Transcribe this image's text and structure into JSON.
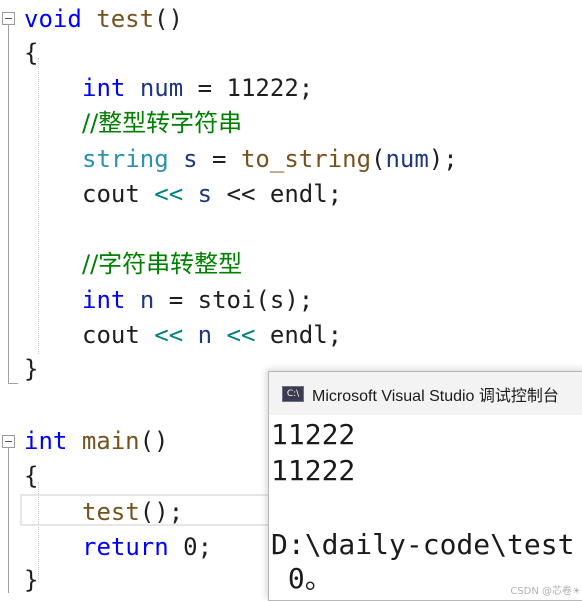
{
  "editor": {
    "test_func": {
      "signature_kw": "void",
      "signature_name": "test",
      "signature_parens": "()",
      "open_brace": "{",
      "close_brace": "}",
      "l1_type": "int",
      "l1_var": "num",
      "l1_rest": " = 11222;",
      "l2_comment": "//整型转字符串",
      "l3_type": "string",
      "l3_var": "s",
      "l3_eq": " = ",
      "l3_fn": "to_string",
      "l3_open": "(",
      "l3_arg": "num",
      "l3_close": ");",
      "l4_cout": "cout ",
      "l4_op1": "<<",
      "l4_var": " s ",
      "l4_op2": "<<",
      "l4_endl": " endl;",
      "l5_comment": "//字符串转整型",
      "l6_type": "int",
      "l6_var": "n",
      "l6_eq": " = ",
      "l6_fn": "stoi",
      "l6_open": "(",
      "l6_arg": "s",
      "l6_close": ");",
      "l7_cout": "cout ",
      "l7_op1": "<<",
      "l7_var": " n ",
      "l7_op2": "<<",
      "l7_endl": " endl;"
    },
    "main_func": {
      "signature_kw": "int",
      "signature_name": "main",
      "signature_parens": "()",
      "open_brace": "{",
      "close_brace": "}",
      "l1_fn": "test",
      "l1_rest": "();",
      "l2_kw": "return",
      "l2_rest": " 0;"
    }
  },
  "console": {
    "title": "Microsoft Visual Studio 调试控制台",
    "icon_text": "C:\\",
    "lines": [
      "11222",
      "11222",
      "",
      "D:\\daily-code\\test",
      " 0。"
    ],
    "watermark": "CSDN @芯卷☀"
  },
  "colors": {
    "keyword": "#0000ff",
    "type": "#2b91af",
    "function": "#74531f",
    "comment": "#008000",
    "variable": "#1f377f"
  }
}
